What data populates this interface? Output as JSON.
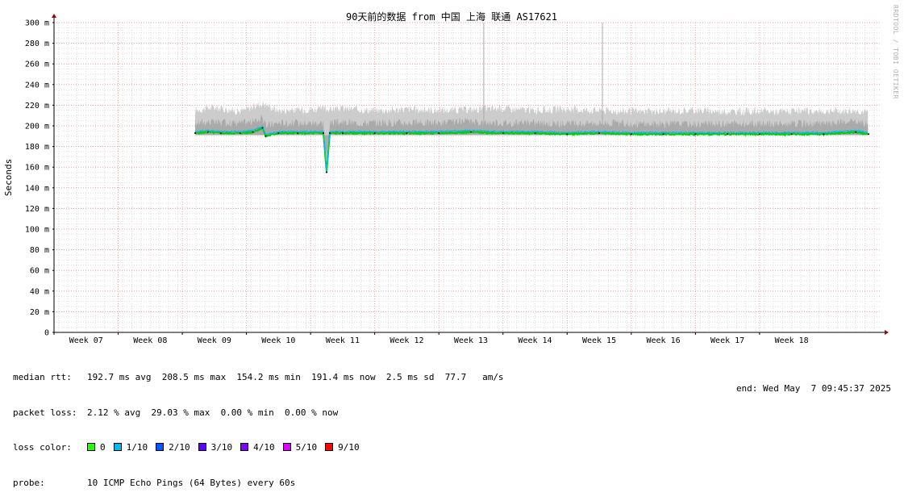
{
  "chart_data": {
    "type": "area",
    "title": "90天前的数据 from 中国 上海 联通 AS17621",
    "xlabel": "",
    "ylabel": "Seconds",
    "ylim": [
      0,
      300
    ],
    "yticks": [
      0,
      20,
      40,
      60,
      80,
      100,
      120,
      140,
      160,
      180,
      200,
      220,
      240,
      260,
      280,
      300
    ],
    "ytick_labels": [
      "0",
      "20 m",
      "40 m",
      "60 m",
      "80 m",
      "100 m",
      "120 m",
      "140 m",
      "160 m",
      "180 m",
      "200 m",
      "220 m",
      "240 m",
      "260 m",
      "280 m",
      "300 m"
    ],
    "x_range_weeks": [
      6.5,
      19.4
    ],
    "xticks": [
      {
        "week": 7,
        "label": "Week 07"
      },
      {
        "week": 8,
        "label": "Week 08"
      },
      {
        "week": 9,
        "label": "Week 09"
      },
      {
        "week": 10,
        "label": "Week 10"
      },
      {
        "week": 11,
        "label": "Week 11"
      },
      {
        "week": 12,
        "label": "Week 12"
      },
      {
        "week": 13,
        "label": "Week 13"
      },
      {
        "week": 14,
        "label": "Week 14"
      },
      {
        "week": 15,
        "label": "Week 15"
      },
      {
        "week": 16,
        "label": "Week 16"
      },
      {
        "week": 17,
        "label": "Week 17"
      },
      {
        "week": 18,
        "label": "Week 18"
      }
    ],
    "grid": true,
    "series": [
      {
        "name": "median rtt",
        "x_weeks": [
          8.7,
          8.9,
          9.1,
          9.4,
          9.6,
          9.75,
          9.8,
          10.0,
          10.3,
          10.7,
          10.75,
          10.8,
          11.0,
          11.5,
          12.0,
          12.5,
          13.0,
          13.5,
          14.0,
          14.5,
          15.0,
          15.5,
          16.0,
          16.5,
          17.0,
          17.5,
          18.0,
          18.5,
          19.0,
          19.2
        ],
        "values": [
          193,
          194,
          193,
          193,
          194,
          198,
          190,
          193,
          193,
          193,
          155,
          193,
          193,
          193,
          193,
          193,
          194,
          193,
          193,
          192,
          193,
          192,
          192,
          192,
          192,
          192,
          192,
          192,
          194,
          192
        ]
      },
      {
        "name": "rtt max envelope",
        "x_weeks": [
          8.7,
          9.0,
          9.4,
          9.75,
          10.0,
          10.5,
          11.0,
          11.5,
          12.0,
          12.5,
          13.0,
          13.5,
          14.0,
          14.5,
          15.0,
          15.5,
          16.0,
          16.5,
          17.0,
          17.5,
          18.0,
          18.5,
          19.0,
          19.2
        ],
        "values": [
          215,
          218,
          214,
          222,
          215,
          216,
          217,
          215,
          216,
          215,
          216,
          217,
          215,
          216,
          215,
          214,
          214,
          215,
          214,
          214,
          214,
          214,
          215,
          213
        ]
      }
    ],
    "spikes": [
      {
        "week": 13.2,
        "value": 300
      },
      {
        "week": 15.05,
        "value": 300
      }
    ],
    "colors": {
      "background": "#ffffff",
      "grid_minor": "#dcdcdc",
      "grid_major": "#f0a0a0",
      "smoke_light": "#cccccc",
      "smoke_mid": "#aaaaaa",
      "median": "#00cc00",
      "axis_arrow": "#a00000"
    }
  },
  "stats": {
    "median_rtt": {
      "label": "median rtt:",
      "text": "192.7 ms avg  208.5 ms max  154.2 ms min  191.4 ms now  2.5 ms sd  77.7   am/s"
    },
    "packet_loss": {
      "label": "packet loss:",
      "text": "2.12 % avg  29.03 % max  0.00 % min  0.00 % now"
    },
    "loss_color": {
      "label": "loss color:",
      "items": [
        {
          "label": "0",
          "color": "#26ff00"
        },
        {
          "label": "1/10",
          "color": "#00b8ff"
        },
        {
          "label": "2/10",
          "color": "#0059ff"
        },
        {
          "label": "3/10",
          "color": "#5e00ff"
        },
        {
          "label": "4/10",
          "color": "#7e00ff"
        },
        {
          "label": "5/10",
          "color": "#dd00ff"
        },
        {
          "label": "9/10",
          "color": "#ff0000"
        }
      ]
    },
    "probe": {
      "label": "probe:",
      "text": "10 ICMP Echo Pings (64 Bytes) every 60s"
    },
    "end": "end: Wed May  7 09:45:37 2025"
  },
  "watermark": "RRDTOOL / TOBI OETIKER"
}
